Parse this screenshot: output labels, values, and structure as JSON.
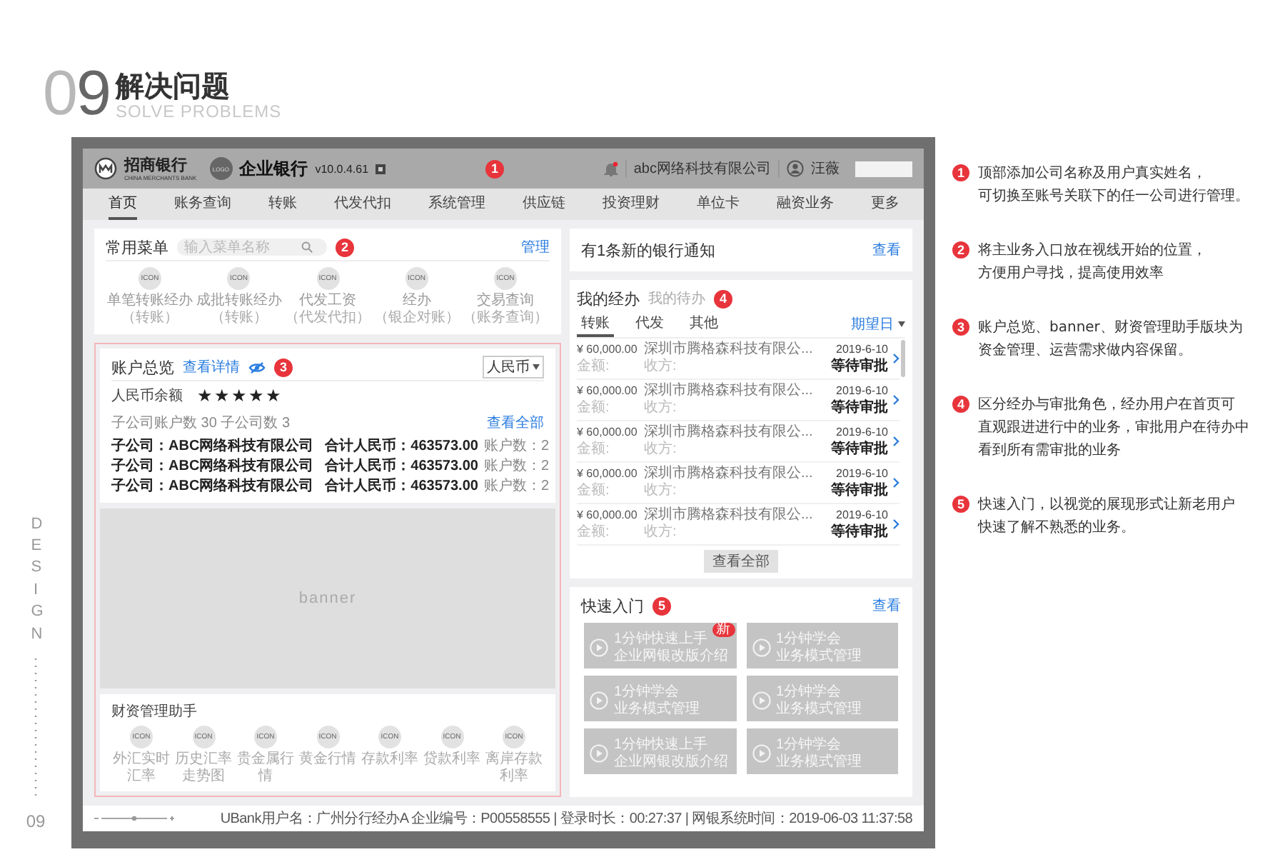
{
  "heading": {
    "number_light": "0",
    "number_dark": "9",
    "title": "解决问题",
    "subtitle": "SOLVE PROBLEMS"
  },
  "side": {
    "label": "DESIGN",
    "page": "09"
  },
  "app": {
    "header": {
      "bank_name": "招商银行",
      "bank_name_en": "CHINA MERCHANTS BANK",
      "logo_text": "LOGO",
      "product": "企业银行",
      "version": "v10.0.4.61",
      "marker": "1",
      "company": "abc网络科技有限公司",
      "user": "汪薇"
    },
    "nav": [
      {
        "label": "首页",
        "selected": true
      },
      {
        "label": "账务查询",
        "selected": false
      },
      {
        "label": "转账",
        "selected": false
      },
      {
        "label": "代发代扣",
        "selected": false
      },
      {
        "label": "系统管理",
        "selected": false
      },
      {
        "label": "供应链",
        "selected": false
      },
      {
        "label": "投资理财",
        "selected": false
      },
      {
        "label": "单位卡",
        "selected": false
      },
      {
        "label": "融资业务",
        "selected": false
      },
      {
        "label": "更多",
        "selected": false
      }
    ],
    "common_menu": {
      "title": "常用菜单",
      "search_placeholder": "输入菜单名称",
      "marker": "2",
      "manage": "管理",
      "items": [
        {
          "icon_text": "ICON",
          "label": "单笔转账经办",
          "sub": "（转账）"
        },
        {
          "icon_text": "ICON",
          "label": "成批转账经办",
          "sub": "（转账）"
        },
        {
          "icon_text": "ICON",
          "label": "代发工资",
          "sub": "（代发代扣）"
        },
        {
          "icon_text": "ICON",
          "label": "经办",
          "sub": "（银企对账）"
        },
        {
          "icon_text": "ICON",
          "label": "交易查询",
          "sub": "（账务查询）"
        }
      ]
    },
    "account_overview": {
      "title": "账户总览",
      "details_link": "查看详情",
      "marker": "3",
      "currency": "人民币",
      "balance_label": "人民币余额",
      "balance": "★★★★★",
      "summary": "子公司账户数 30 子公司数 3",
      "view_all": "查看全部",
      "rows": [
        {
          "company": "子公司：ABC网络科技有限公司",
          "total": "合计人民币：463573.00",
          "accounts": "账户数：2"
        },
        {
          "company": "子公司：ABC网络科技有限公司",
          "total": "合计人民币：463573.00",
          "accounts": "账户数：2"
        },
        {
          "company": "子公司：ABC网络科技有限公司",
          "total": "合计人民币：463573.00",
          "accounts": "账户数：2"
        }
      ]
    },
    "banner": {
      "text": "banner"
    },
    "finance_assistant": {
      "title": "财资管理助手",
      "items": [
        {
          "icon_text": "ICON",
          "label": "外汇实时汇率"
        },
        {
          "icon_text": "ICON",
          "label": "历史汇率走势图"
        },
        {
          "icon_text": "ICON",
          "label": "贵金属行情"
        },
        {
          "icon_text": "ICON",
          "label": "黄金行情"
        },
        {
          "icon_text": "ICON",
          "label": "存款利率"
        },
        {
          "icon_text": "ICON",
          "label": "贷款利率"
        },
        {
          "icon_text": "ICON",
          "label": "离岸存款利率"
        }
      ]
    },
    "notice": {
      "text": "有1条新的银行通知",
      "link": "查看"
    },
    "tasks": {
      "marker": "4",
      "tabs": [
        {
          "label": "我的经办",
          "selected": true
        },
        {
          "label": "我的待办",
          "selected": false
        }
      ],
      "subtabs": [
        {
          "label": "转账",
          "selected": true
        },
        {
          "label": "代发",
          "selected": false
        },
        {
          "label": "其他",
          "selected": false
        }
      ],
      "sort": "期望日",
      "view_all": "查看全部",
      "rows": [
        {
          "amount": "¥ 60,000.00",
          "amount_label": "金额:",
          "payee": "深圳市腾格森科技有限公...",
          "payee_label": "收方:",
          "date": "2019-6-10",
          "status": "等待审批"
        },
        {
          "amount": "¥ 60,000.00",
          "amount_label": "金额:",
          "payee": "深圳市腾格森科技有限公...",
          "payee_label": "收方:",
          "date": "2019-6-10",
          "status": "等待审批"
        },
        {
          "amount": "¥ 60,000.00",
          "amount_label": "金额:",
          "payee": "深圳市腾格森科技有限公...",
          "payee_label": "收方:",
          "date": "2019-6-10",
          "status": "等待审批"
        },
        {
          "amount": "¥ 60,000.00",
          "amount_label": "金额:",
          "payee": "深圳市腾格森科技有限公...",
          "payee_label": "收方:",
          "date": "2019-6-10",
          "status": "等待审批"
        },
        {
          "amount": "¥ 60,000.00",
          "amount_label": "金额:",
          "payee": "深圳市腾格森科技有限公...",
          "payee_label": "收方:",
          "date": "2019-6-10",
          "status": "等待审批"
        }
      ]
    },
    "quick_start": {
      "title": "快速入门",
      "marker": "5",
      "link": "查看",
      "tiles": [
        {
          "line1": "1分钟快速上手",
          "line2": "企业网银改版介绍",
          "badge": "新"
        },
        {
          "line1": "1分钟学会",
          "line2": "业务模式管理"
        },
        {
          "line1": "1分钟学会",
          "line2": "业务模式管理"
        },
        {
          "line1": "1分钟学会",
          "line2": "业务模式管理"
        },
        {
          "line1": "1分钟快速上手",
          "line2": "企业网银改版介绍"
        },
        {
          "line1": "1分钟学会",
          "line2": "业务模式管理"
        }
      ]
    },
    "footer": {
      "status": "UBank用户名：广州分行经办A  企业编号：P00558555 | 登录时长：00:27:37 | 网银系统时间：2019-06-03 11:37:58"
    }
  },
  "notes": [
    {
      "marker": "1",
      "lines": [
        "顶部添加公司名称及用户真实姓名，",
        "可切换至账号关联下的任一公司进行管理。"
      ]
    },
    {
      "marker": "2",
      "lines": [
        "将主业务入口放在视线开始的位置，",
        "方便用户寻找，提高使用效率"
      ]
    },
    {
      "marker": "3",
      "lines": [
        "账户总览、banner、财资管理助手版块为",
        "资金管理、运营需求做内容保留。"
      ]
    },
    {
      "marker": "4",
      "lines": [
        "区分经办与审批角色，经办用户在首页可",
        "直观跟进进行中的业务，审批用户在待办中",
        "看到所有需审批的业务"
      ]
    },
    {
      "marker": "5",
      "lines": [
        "快速入门，以视觉的展现形式让新老用户",
        "快速了解不熟悉的业务。"
      ]
    }
  ]
}
